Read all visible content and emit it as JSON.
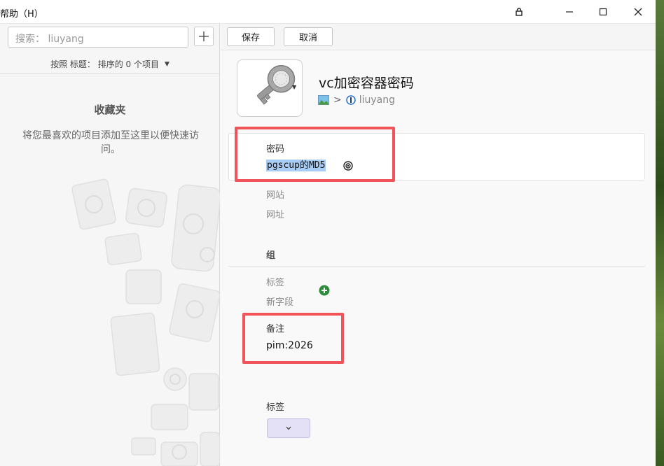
{
  "menu": {
    "help": "帮助（H）"
  },
  "sidebar": {
    "search_placeholder": "搜索： liuyang",
    "sort_text": "按照 标题：  排序的 0 个项目",
    "favorites_title": "收藏夹",
    "favorites_desc": "将您最喜欢的项目添加至这里以便快速访问。"
  },
  "toolbar": {
    "save_label": "保存",
    "cancel_label": "取消"
  },
  "item": {
    "title": "vc加密容器密码",
    "vault_name": "liuyang",
    "path_separator": ">"
  },
  "fields": {
    "password_label": "密码",
    "password_value": "pgscup的MD5",
    "website_label": "网站",
    "url_label": "网址",
    "group_label": "组",
    "tags_label": "标签",
    "new_field_label": "新字段",
    "notes_label": "备注",
    "notes_value": "pim:2026",
    "tags_section_label": "标签"
  },
  "colors": {
    "highlight_box": "#f0535a",
    "selection": "#a9cdf4",
    "add_green": "#2e8b3a",
    "tag_bg": "#e4e0f6"
  },
  "icons": [
    "lock-icon",
    "minimize-icon",
    "maximize-icon",
    "close-icon",
    "plus-icon",
    "key-icon",
    "vault-icon",
    "reveal-icon",
    "add-field-icon",
    "chevron-down-icon"
  ]
}
